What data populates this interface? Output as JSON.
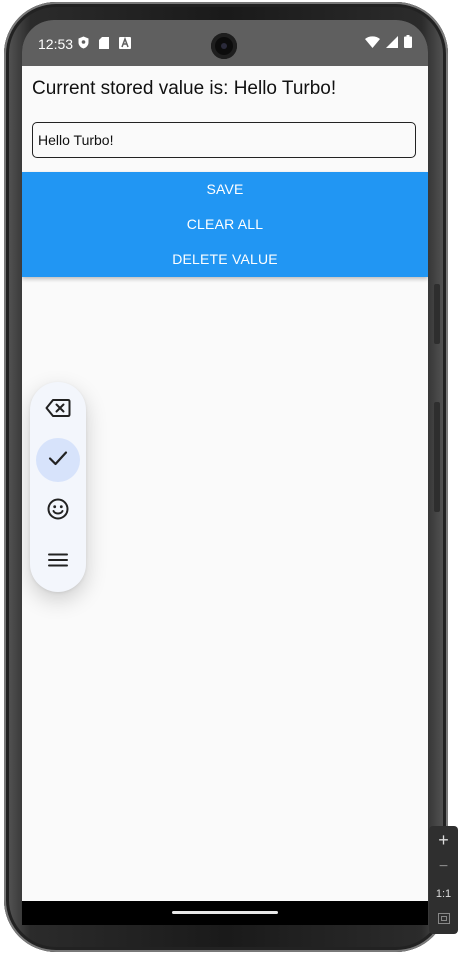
{
  "status_bar": {
    "time": "12:53",
    "left_icons": [
      "shield-icon",
      "sd-card-icon",
      "keyboard-a-icon"
    ],
    "right_icons": [
      "wifi-icon",
      "cell-signal-icon",
      "battery-icon"
    ]
  },
  "app": {
    "stored_value_text": "Current stored value is: Hello Turbo!",
    "input_value": "Hello Turbo!",
    "buttons": {
      "save": "SAVE",
      "clear_all": "CLEAR ALL",
      "delete_value": "DELETE VALUE"
    },
    "accent_color": "#2196f3"
  },
  "floating_toolbar": {
    "items": [
      "backspace-icon",
      "check-icon",
      "emoji-icon",
      "menu-icon"
    ],
    "active_item": "check-icon"
  },
  "emulator_zoom": {
    "plus": "+",
    "minus": "−",
    "ratio": "1:1"
  }
}
